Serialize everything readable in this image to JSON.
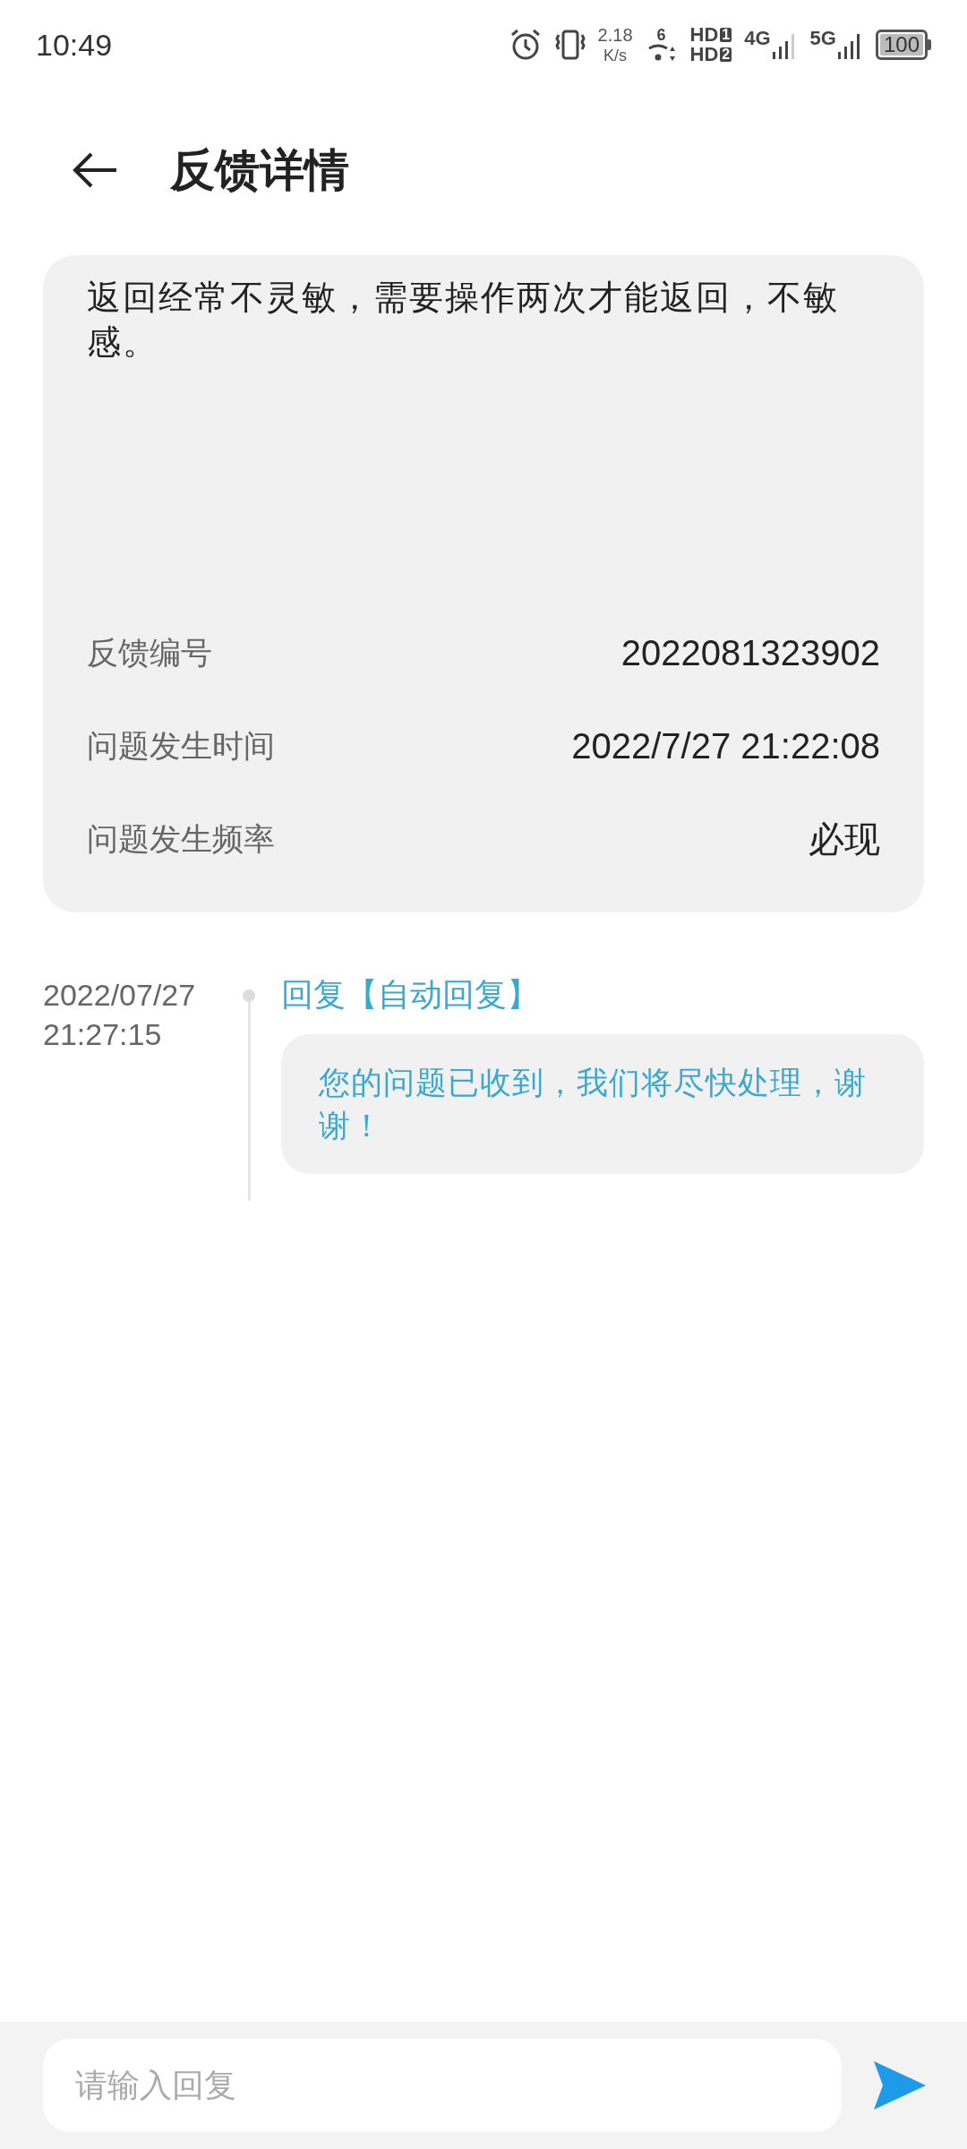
{
  "status_bar": {
    "time": "10:49",
    "speed_value": "2.18",
    "speed_unit": "K/s",
    "wifi_label": "6",
    "hd_1": "HD",
    "hd_1_badge": "1",
    "hd_2": "HD",
    "hd_2_badge": "2",
    "network_1": "4G",
    "network_2": "5G",
    "battery": "100"
  },
  "header": {
    "title": "反馈详情"
  },
  "feedback": {
    "description": "返回经常不灵敏，需要操作两次才能返回，不敏感。",
    "fields": [
      {
        "label": "反馈编号",
        "value": "2022081323902"
      },
      {
        "label": "问题发生时间",
        "value": "2022/7/27 21:22:08"
      },
      {
        "label": "问题发生频率",
        "value": "必现"
      }
    ]
  },
  "replies": [
    {
      "date": "2022/07/27",
      "time": "21:27:15",
      "title": "回复【自动回复】",
      "message": "您的问题已收到，我们将尽快处理，谢谢！"
    }
  ],
  "reply_input": {
    "placeholder": "请输入回复"
  }
}
